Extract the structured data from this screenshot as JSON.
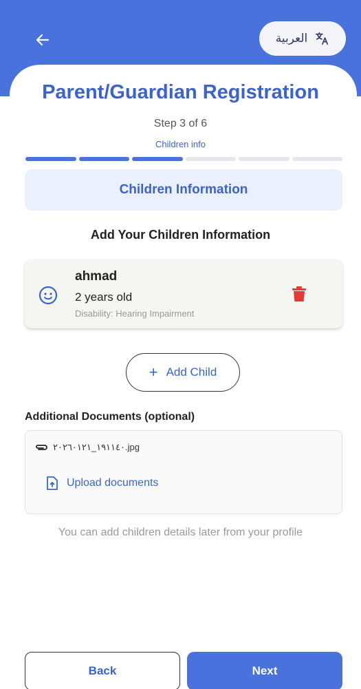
{
  "header": {
    "back_icon": "arrow-left-icon",
    "language_button_label": "العربية",
    "translate_icon": "translate-icon"
  },
  "page": {
    "title": "Parent/Guardian Registration",
    "step_text": "Step 3 of 6",
    "step_name": "Children info",
    "progress": {
      "current_step": 3,
      "total_steps": 6
    }
  },
  "section": {
    "banner_title": "Children Information",
    "subheading": "Add Your Children Information"
  },
  "children": [
    {
      "name": "ahmad",
      "age": "2 years old",
      "disability": "Disability: Hearing Impairment",
      "icon": "child-face-icon"
    }
  ],
  "actions": {
    "add_child_label": "Add Child"
  },
  "documents": {
    "label": "Additional Documents (optional)",
    "files": [
      "١٩١١٤٠_٢٠٢٦٠١٢١.jpg"
    ],
    "upload_label": "Upload documents"
  },
  "hint": "You can add children details later from your profile",
  "footer": {
    "back_label": "Back",
    "next_label": "Next"
  },
  "colors": {
    "primary": "#4a72dd",
    "accent_text": "#3a63d0",
    "delete": "#e53935"
  }
}
